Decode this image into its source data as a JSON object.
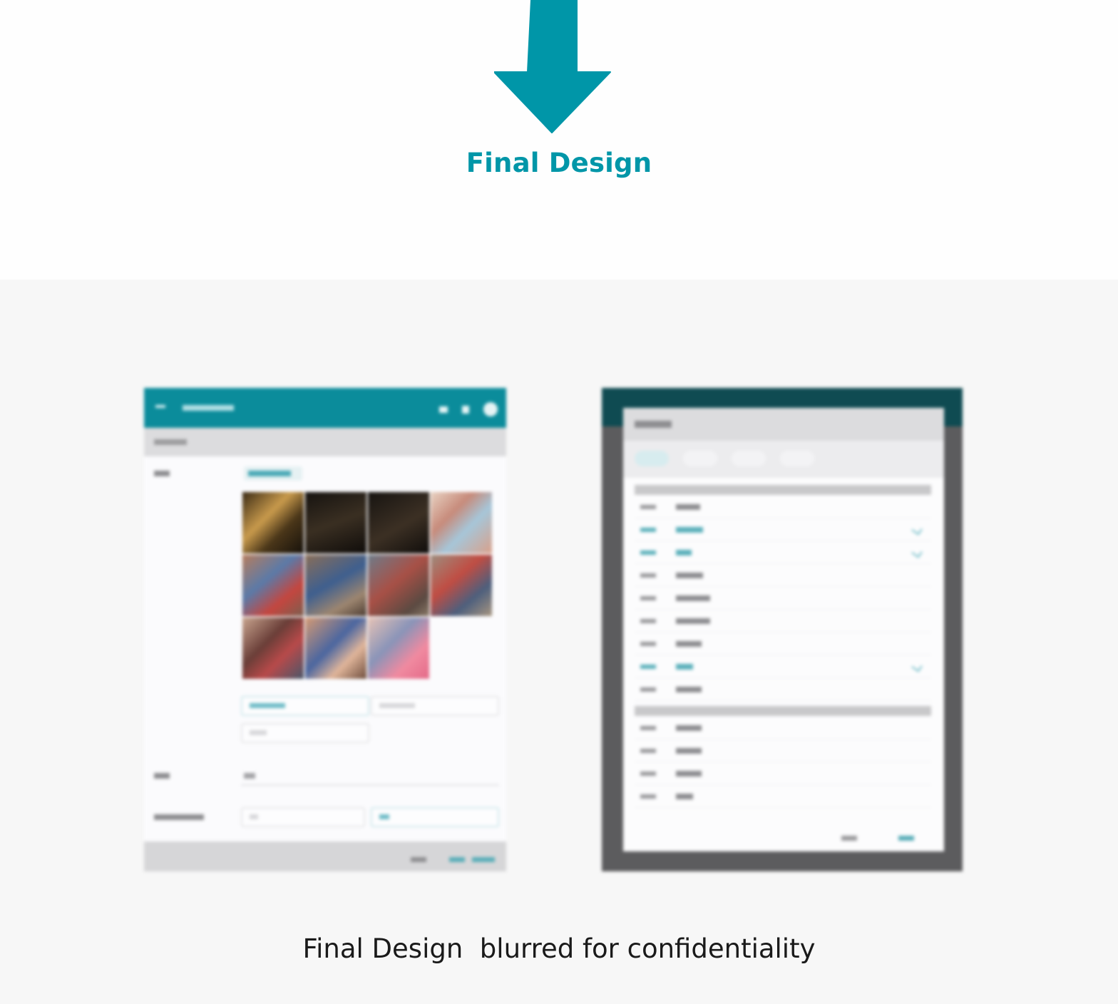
{
  "colors": {
    "accent": "#0096a8"
  },
  "header": {
    "icon": "arrow-down-icon",
    "title": "Final Design"
  },
  "caption": {
    "text": "Final Design  blurred for confidentiality"
  },
  "screenshots": [
    {
      "name": "left-screenshot",
      "style": "blurred"
    },
    {
      "name": "right-screenshot",
      "style": "blurred"
    }
  ]
}
